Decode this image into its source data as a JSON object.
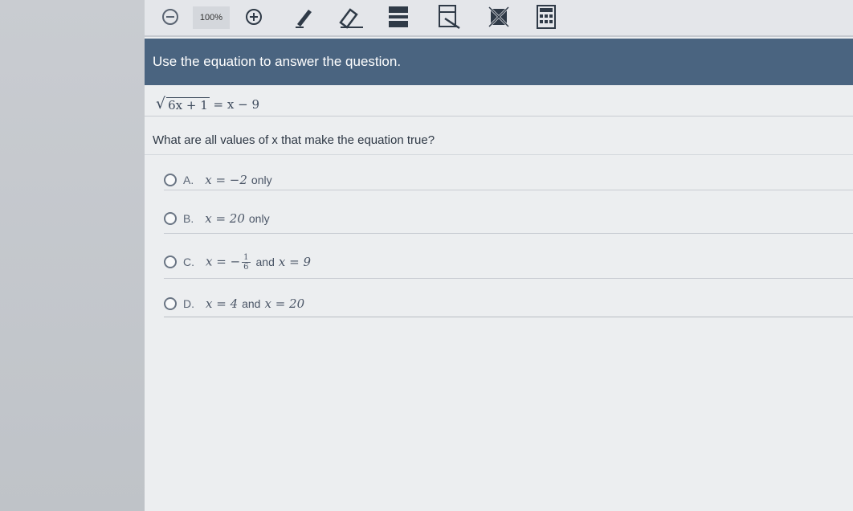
{
  "toolbar": {
    "zoom_out_icon": "zoom-out-icon",
    "zoom_level": "100%",
    "zoom_in_icon": "zoom-in-icon",
    "tools": [
      "pencil-icon",
      "eraser-icon",
      "line-reader-icon",
      "highlighter-icon",
      "answer-eliminator-icon",
      "calculator-icon"
    ]
  },
  "instruction": "Use the equation to answer the question.",
  "equation": {
    "radicand": "6x + 1",
    "rhs": "= x − 9"
  },
  "question": "What are all values of x that make the equation true?",
  "choices": [
    {
      "letter": "A.",
      "expr": "x = −2",
      "suffix": "only"
    },
    {
      "letter": "B.",
      "expr": "x = 20",
      "suffix": "only"
    },
    {
      "letter": "C.",
      "expr_prefix": "x = −",
      "frac_num": "1",
      "frac_den": "6",
      "middle": "and",
      "expr2": "x = 9"
    },
    {
      "letter": "D.",
      "expr": "x = 4",
      "middle": "and",
      "expr2": "x = 20"
    }
  ],
  "colors": {
    "instruction_bar": "#4a6480",
    "background": "#eceef0"
  }
}
